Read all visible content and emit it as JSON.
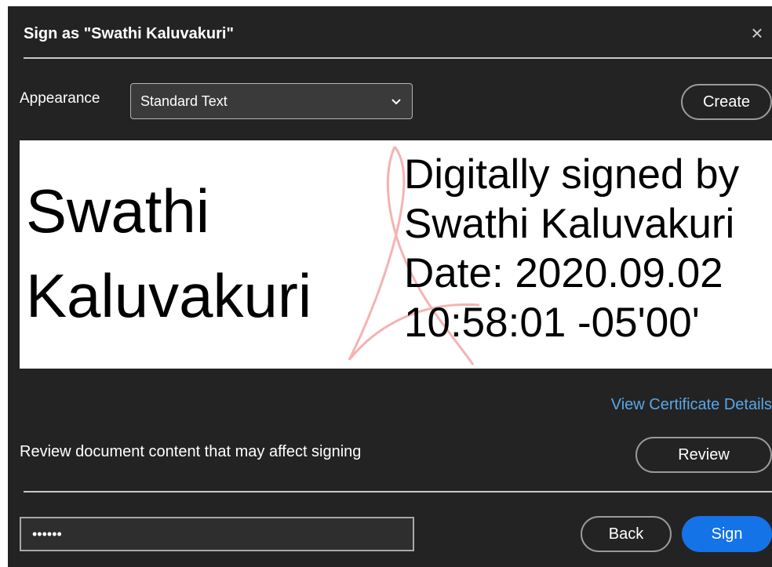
{
  "dialog": {
    "title": "Sign as \"Swathi Kaluvakuri\"",
    "close_icon": "close-icon",
    "close_glyph": "×"
  },
  "appearance": {
    "label": "Appearance",
    "selected": "Standard Text",
    "create_label": "Create"
  },
  "preview": {
    "name_line1": "Swathi",
    "name_line2": "Kaluvakuri",
    "details": [
      "Digitally signed by",
      "Swathi Kaluvakuri",
      "Date: 2020.09.02",
      "10:58:01 -05'00'"
    ],
    "watermark_icon": "acrobat-logo-watermark",
    "watermark_color": "#f4b3b3"
  },
  "certificate": {
    "link_label": "View Certificate Details"
  },
  "review": {
    "text": "Review document content that may affect signing",
    "button_label": "Review"
  },
  "footer": {
    "password_value": "••••••",
    "back_label": "Back",
    "sign_label": "Sign"
  },
  "colors": {
    "dialog_bg": "#232323",
    "accent": "#1473e6",
    "link": "#5aa7e6"
  }
}
